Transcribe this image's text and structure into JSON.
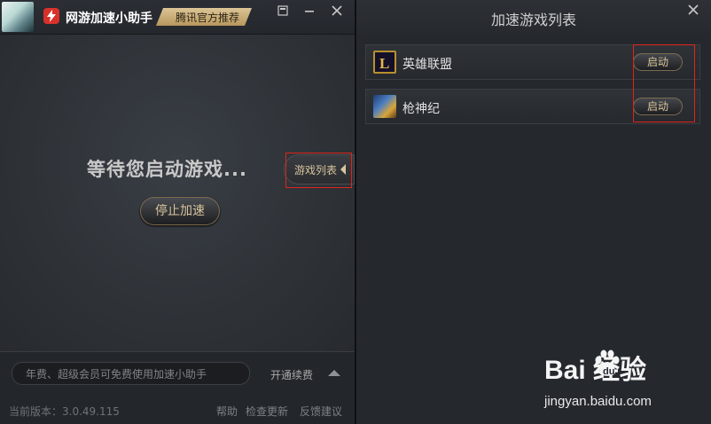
{
  "left_window": {
    "title": "网游加速小助手",
    "badge": "腾讯官方推荐",
    "status_text": "等待您启动游戏...",
    "stop_button": "停止加速",
    "game_list_tab": "游戏列表",
    "notice": "年费、超级会员可免费使用加速小助手",
    "renew": "开通续费",
    "version": "当前版本：3.0.49.115",
    "links": {
      "help": "帮助",
      "update": "检查更新",
      "feedback": "反馈建议"
    }
  },
  "right_window": {
    "title": "加速游戏列表",
    "games": [
      {
        "name": "英雄联盟",
        "button": "启动",
        "icon": "lol-icon"
      },
      {
        "name": "枪神纪",
        "button": "启动",
        "icon": "tps-game-icon"
      }
    ]
  },
  "watermark": {
    "logo": "Bai  经验",
    "url": "jingyan.baidu.com"
  },
  "colors": {
    "accent_gold": "#d8c49c",
    "highlight_red": "#e0241a",
    "logo_red": "#d8312b"
  }
}
